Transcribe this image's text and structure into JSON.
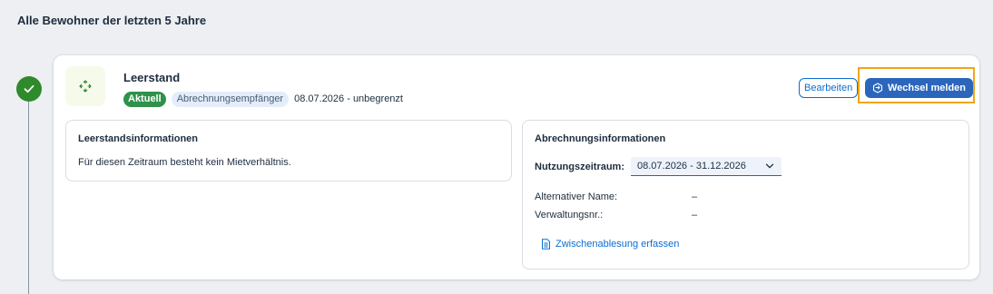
{
  "section": {
    "title": "Alle Bewohner der letzten 5 Jahre"
  },
  "card": {
    "title": "Leerstand",
    "status_badge": "Aktuell",
    "role_badge": "Abrechnungsempfänger",
    "date_range": "08.07.2026 - unbegrenzt",
    "edit_label": "Bearbeiten",
    "change_label": "Wechsel melden",
    "icons": {
      "avatar": "move-icon",
      "status": "checkmark-icon",
      "change": "exchange-icon"
    }
  },
  "vacancy_panel": {
    "title": "Leerstandsinformationen",
    "text": "Für diesen Zeitraum besteht kein Mietverhältnis."
  },
  "billing_panel": {
    "title": "Abrechnungsinformationen",
    "period_label": "Nutzungszeitraum:",
    "period_value": "08.07.2026 - 31.12.2026",
    "alt_name_label": "Alternativer Name:",
    "alt_name_value": "–",
    "admin_no_label": "Verwaltungsnr.:",
    "admin_no_value": "–",
    "link_label": "Zwischenablesung erfassen"
  },
  "colors": {
    "success": "#2e8a2a",
    "accent": "#0a6ed1",
    "primary": "#2b66bc",
    "highlight": "#f0a518"
  }
}
